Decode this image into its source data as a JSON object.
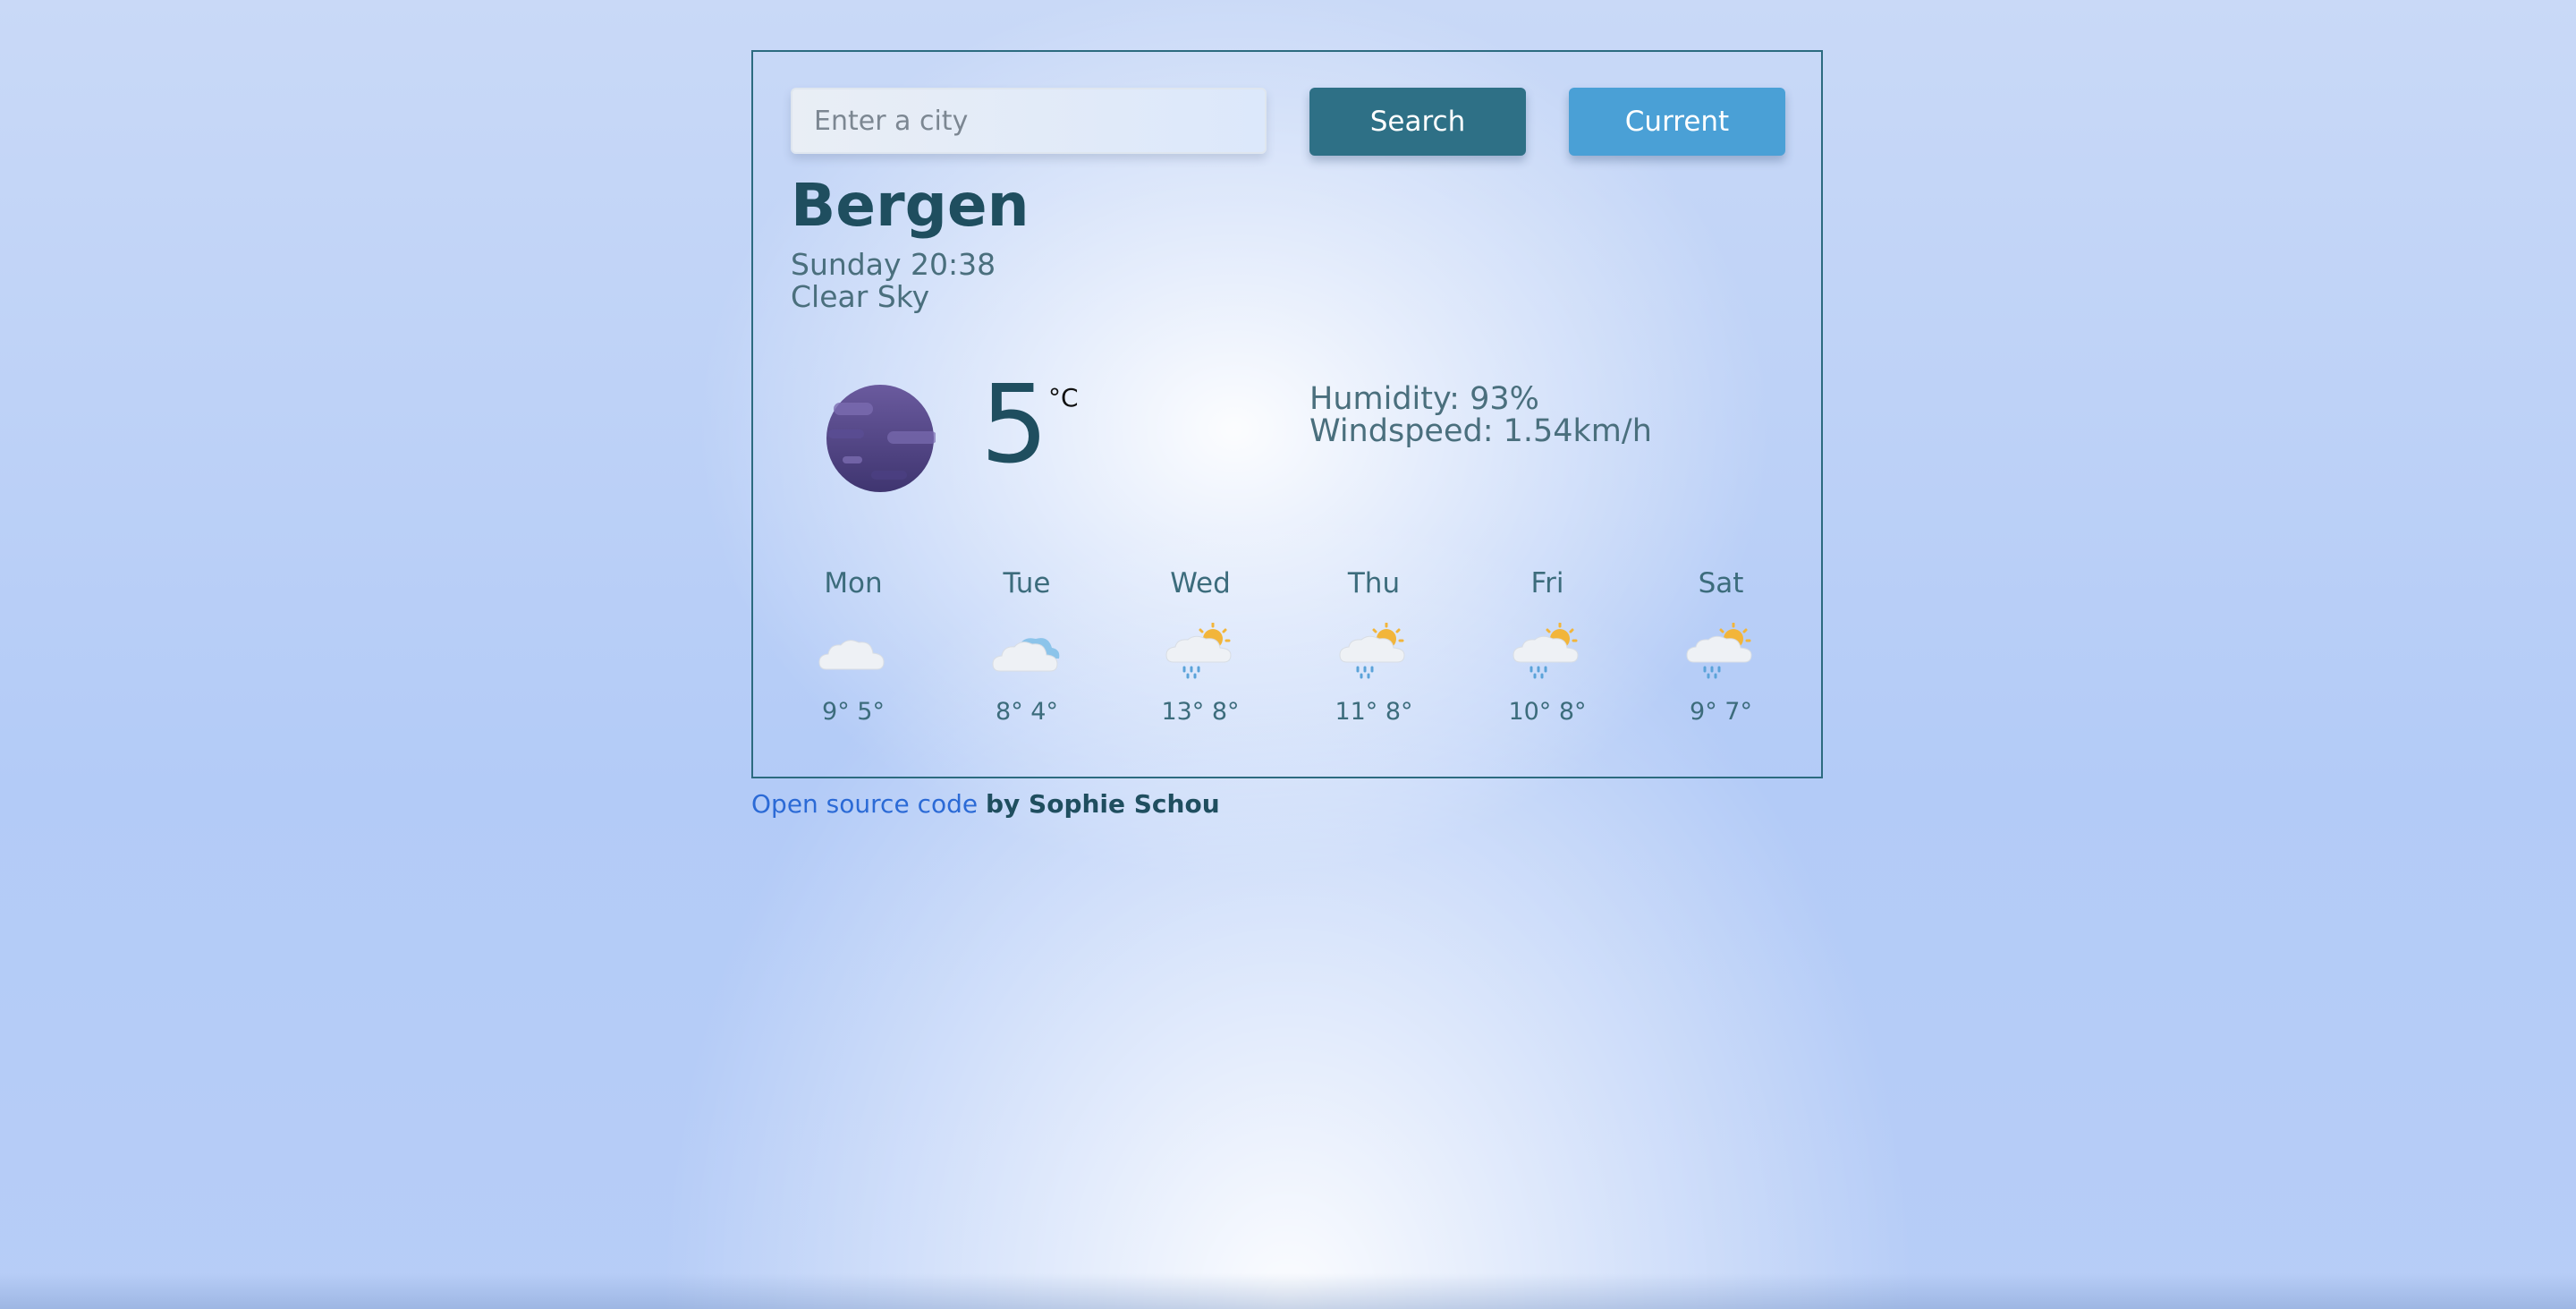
{
  "search": {
    "placeholder": "Enter a city",
    "value": "",
    "search_label": "Search",
    "current_label": "Current"
  },
  "current": {
    "city": "Bergen",
    "day_time": "Sunday 20:38",
    "description": "Clear Sky",
    "icon": "night-clear-icon",
    "temperature": "5",
    "unit": "°C",
    "humidity": "Humidity: 93%",
    "windspeed": "Windspeed: 1.54km/h"
  },
  "forecast": [
    {
      "day": "Mon",
      "icon": "cloud-icon",
      "temps": "9° 5°"
    },
    {
      "day": "Tue",
      "icon": "cloud-icon",
      "temps": "8° 4°"
    },
    {
      "day": "Wed",
      "icon": "sun-rain-cloud-icon",
      "temps": "13° 8°"
    },
    {
      "day": "Thu",
      "icon": "sun-rain-cloud-icon",
      "temps": "11° 8°"
    },
    {
      "day": "Fri",
      "icon": "sun-rain-cloud-icon",
      "temps": "10° 8°"
    },
    {
      "day": "Sat",
      "icon": "sun-rain-cloud-icon",
      "temps": "9° 7°"
    }
  ],
  "footer": {
    "link_text": "Open source code",
    "author_text": "by Sophie Schou"
  },
  "colors": {
    "primary": "#2e7086",
    "accent": "#4aa0d6",
    "heading": "#1f4e5f",
    "link": "#2b6ad6"
  }
}
